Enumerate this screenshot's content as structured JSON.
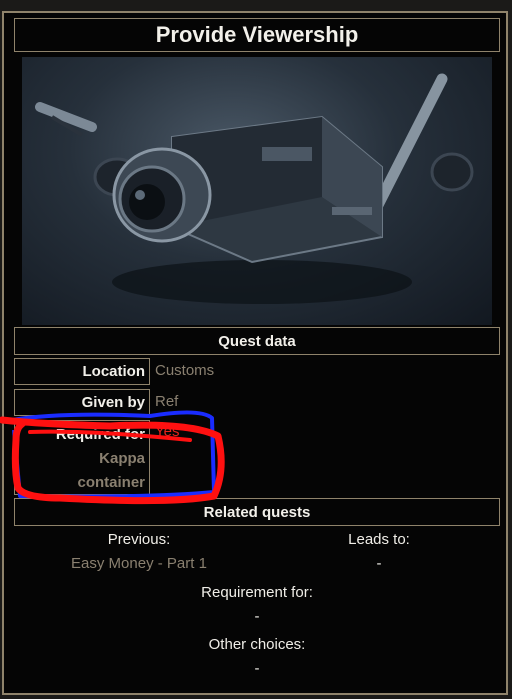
{
  "title": "Provide Viewership",
  "quest_data": {
    "header": "Quest data",
    "location_label": "Location",
    "location_value": "Customs",
    "given_by_label": "Given by",
    "given_by_value": "Ref",
    "required_for_label": "Required for",
    "required_for_kappa": "Kappa",
    "required_for_container": "container",
    "required_for_value": "Yes"
  },
  "related": {
    "header": "Related quests",
    "previous_label": "Previous:",
    "previous_value": "Easy Money - Part 1",
    "leads_to_label": "Leads to:",
    "leads_to_value": "-",
    "requirement_for_label": "Requirement for:",
    "requirement_for_value": "-",
    "other_choices_label": "Other choices:",
    "other_choices_value": "-"
  },
  "image": {
    "icon": "camera-icon"
  },
  "colors": {
    "border": "#8f836b",
    "muted_text": "#8a8070",
    "highlight": "#e8221a",
    "annotation_red": "#ff1010",
    "annotation_blue": "#1a2cff"
  }
}
